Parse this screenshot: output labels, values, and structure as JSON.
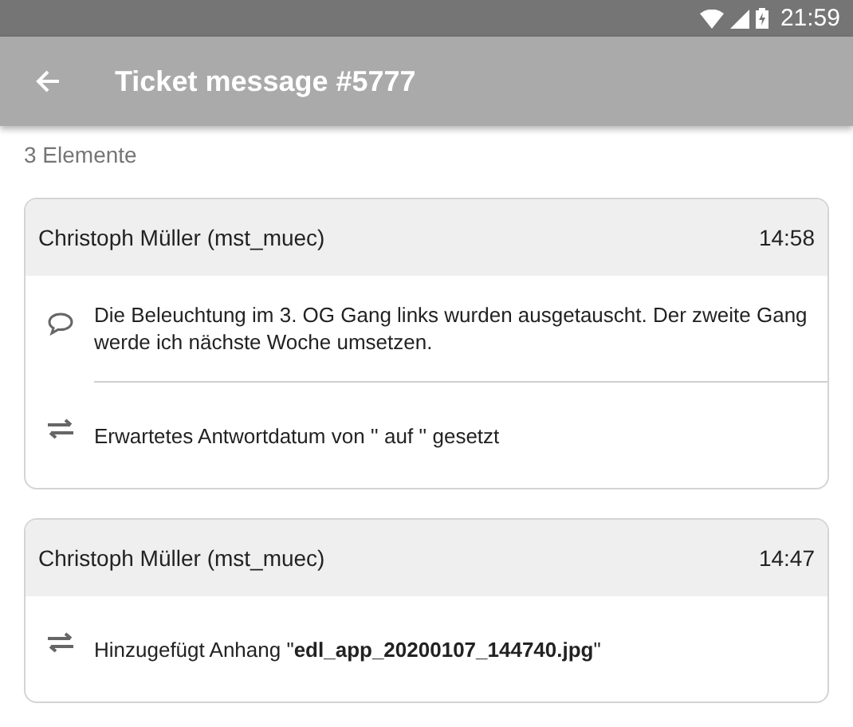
{
  "status_bar": {
    "time": "21:59"
  },
  "app_bar": {
    "title": "Ticket message #5777"
  },
  "count": "3 Elemente",
  "messages": [
    {
      "author": "Christoph Müller (mst_muec)",
      "time": "14:58",
      "entries": [
        {
          "kind": "comment",
          "text": "Die Beleuchtung im 3. OG Gang links wurden ausgetauscht. Der zweite Gang werde ich nächste Woche umsetzen."
        },
        {
          "kind": "change",
          "text": "Erwartetes Antwortdatum von '' auf '' gesetzt"
        }
      ]
    },
    {
      "author": "Christoph Müller (mst_muec)",
      "time": "14:47",
      "entries": [
        {
          "kind": "change",
          "text": "Hinzugefügt Anhang \"**edl_app_20200107_144740.jpg**\""
        }
      ]
    }
  ]
}
